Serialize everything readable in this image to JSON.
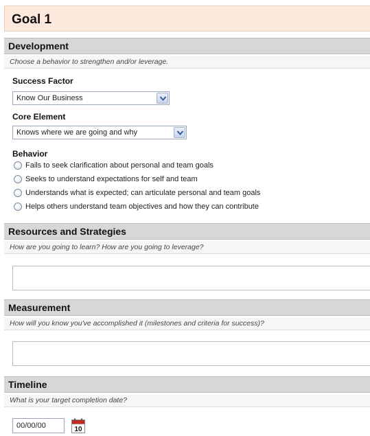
{
  "goal": {
    "title": "Goal 1"
  },
  "development": {
    "header": "Development",
    "description": "Choose a behavior to strengthen and/or leverage.",
    "success_factor": {
      "label": "Success Factor",
      "selected": "Know Our Business"
    },
    "core_element": {
      "label": "Core Element",
      "selected": "Knows where we are going and why"
    },
    "behavior": {
      "label": "Behavior",
      "options": [
        "Fails to seek clarification about personal and team goals",
        "Seeks to understand expectations for self and team",
        "Understands what is expected; can articulate personal and team goals",
        "Helps others understand team objectives and how they can contribute"
      ]
    }
  },
  "resources": {
    "header": "Resources and Strategies",
    "description": "How are you going to learn? How are you going to leverage?",
    "value": ""
  },
  "measurement": {
    "header": "Measurement",
    "description": "How will you know you've accomplished it (milestones and criteria for success)?",
    "value": ""
  },
  "timeline": {
    "header": "Timeline",
    "description": "What is your target completion date?",
    "date_value": "00/00/00",
    "calendar_day": "10"
  },
  "icons": {
    "dropdown": "chevron-down-icon",
    "calendar": "calendar-icon"
  },
  "colors": {
    "goal_header_bg": "#fde9dc",
    "section_header_bg": "#d7d7d7",
    "calendar_red": "#c8281e"
  }
}
